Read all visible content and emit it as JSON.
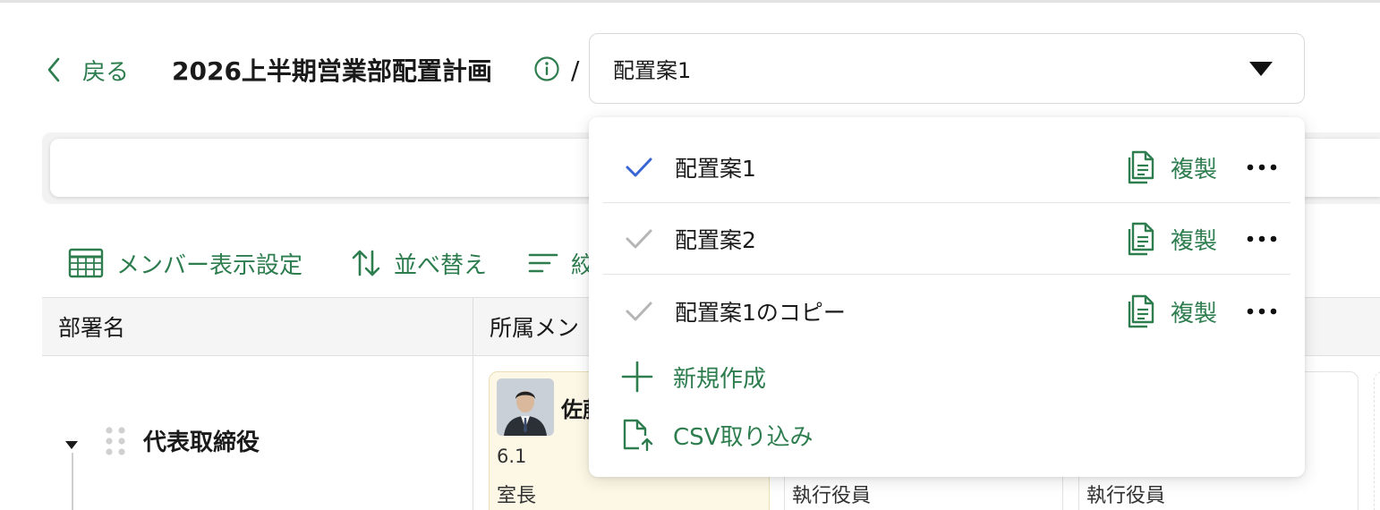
{
  "header": {
    "back_label": "戻る",
    "plan_title": "2026上半期営業部配置計画",
    "separator": "/"
  },
  "plan_select": {
    "selected": "配置案1"
  },
  "toolbar": {
    "member_display": "メンバー表示設定",
    "sort": "並べ替え",
    "filter": "絞"
  },
  "table": {
    "columns": [
      "部署名",
      "所属メン"
    ],
    "rows": [
      {
        "department": "代表取締役",
        "cards": [
          {
            "name": "佐藤",
            "grade": "6.1",
            "role": "室長"
          },
          {
            "role": "執行役員"
          },
          {
            "role": "執行役員"
          }
        ]
      }
    ]
  },
  "dropdown": {
    "options": [
      {
        "label": "配置案1",
        "selected": true,
        "duplicate_label": "複製"
      },
      {
        "label": "配置案2",
        "selected": false,
        "duplicate_label": "複製"
      },
      {
        "label": "配置案1のコピー",
        "selected": false,
        "duplicate_label": "複製"
      }
    ],
    "new_label": "新規作成",
    "csv_import_label": "CSV取り込み"
  },
  "colors": {
    "accent_green": "#2e7d4f",
    "check_selected": "#3a66d4",
    "check_unselected": "#b5b5b5",
    "highlight_card": "#fdf8e6"
  },
  "icons": {
    "back": "chevron-left-icon",
    "info": "info-icon",
    "caret": "caret-down-icon",
    "member_display": "table-grid-icon",
    "sort": "sort-arrows-icon",
    "filter": "filter-lines-icon",
    "check": "check-icon",
    "duplicate": "copy-document-icon",
    "more": "more-horizontal-icon",
    "new": "plus-icon",
    "csv": "file-upload-icon",
    "drag": "drag-handle-icon"
  }
}
